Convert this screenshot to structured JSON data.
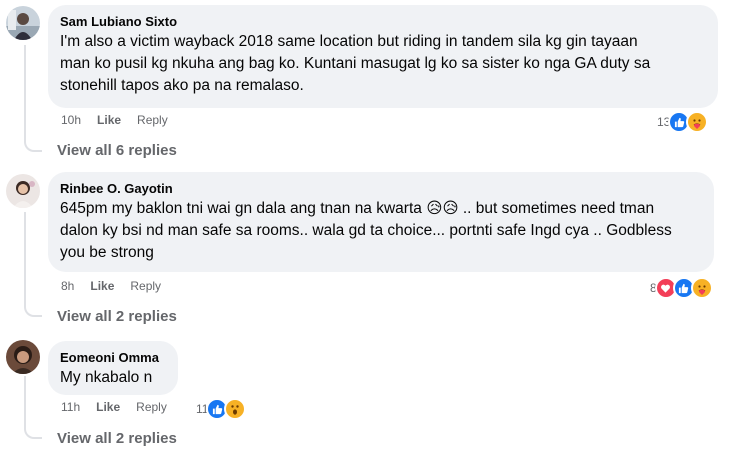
{
  "comments": [
    {
      "author": "Sam Lubiano Sixto",
      "lines": [
        "I'm also a victim wayback 2018 same location but riding in tandem sila kg gin tayaan",
        "man ko pusil kg nkuha ang bag ko. Kuntani masugat lg ko sa sister ko nga GA duty sa",
        "stonehill tapos ako pa na remalaso."
      ],
      "time": "10h",
      "like_label": "Like",
      "reply_label": "Reply",
      "reaction_count": "13",
      "reactions": [
        "like",
        "care"
      ],
      "view_replies": "View all 6 replies"
    },
    {
      "author": "Rinbee O. Gayotin",
      "lines": [
        "645pm my baklon tni wai gn dala ang tnan na kwarta 😥😥 .. but sometimes need tman",
        "dalon ky bsi nd man safe sa rooms.. wala gd ta choice... portnti safe Ingd cya .. Godbless",
        "you be strong"
      ],
      "time": "8h",
      "like_label": "Like",
      "reply_label": "Reply",
      "reaction_count": "8",
      "reactions": [
        "love",
        "like",
        "care"
      ],
      "view_replies": "View all 2 replies"
    },
    {
      "author": "Eomeoni Omma",
      "lines": [
        "My nkabalo n"
      ],
      "time": "11h",
      "like_label": "Like",
      "reply_label": "Reply",
      "reaction_count": "11",
      "reactions": [
        "like",
        "wow"
      ],
      "view_replies": "View all 2 replies"
    }
  ],
  "colors": {
    "bubble": "#f0f2f5",
    "like": "#1877f2",
    "love": "#f33e58",
    "care": "#f7b125",
    "meta": "#65676b"
  }
}
